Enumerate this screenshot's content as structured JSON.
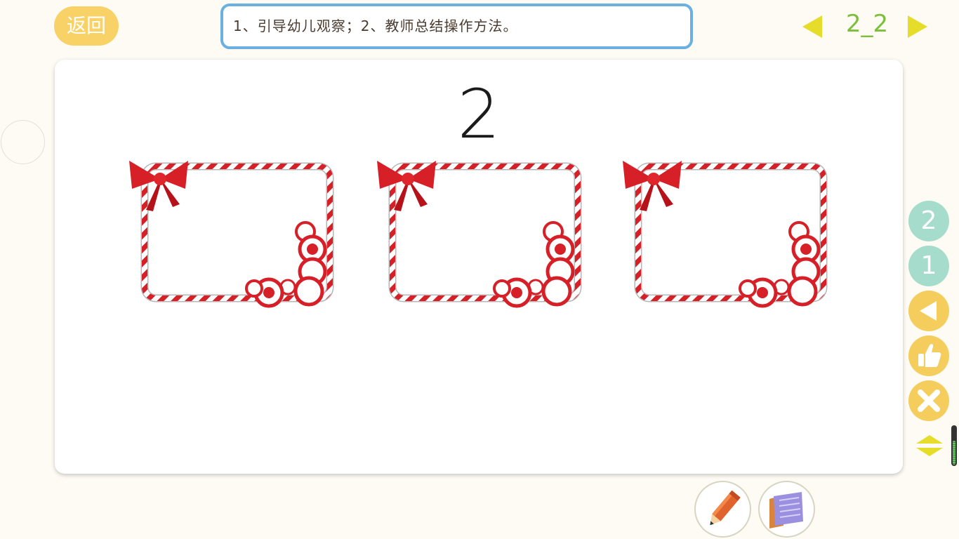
{
  "header": {
    "back_label": "返回",
    "instruction": "1、引导幼儿观察；2、教师总结操作方法。",
    "page_number": "2_2"
  },
  "main": {
    "number": "2",
    "frames": [
      "frame-1",
      "frame-2",
      "frame-3"
    ]
  },
  "side": {
    "btn_two": "2",
    "btn_one": "1",
    "icons": [
      "play-left-icon",
      "thumbs-up-icon",
      "close-icon",
      "collapse-toggle-icon"
    ]
  },
  "tools": {
    "icons": [
      "pencil-icon",
      "book-icon"
    ]
  },
  "colors": {
    "background": "#fdfbf3",
    "accent_gold": "#f5cd5c",
    "mint": "#a5dccb",
    "instruction_border": "#6ab1e1",
    "page_number": "#7bbf3a",
    "arrow": "#e6dc2a",
    "candy_red": "#d61f26"
  }
}
